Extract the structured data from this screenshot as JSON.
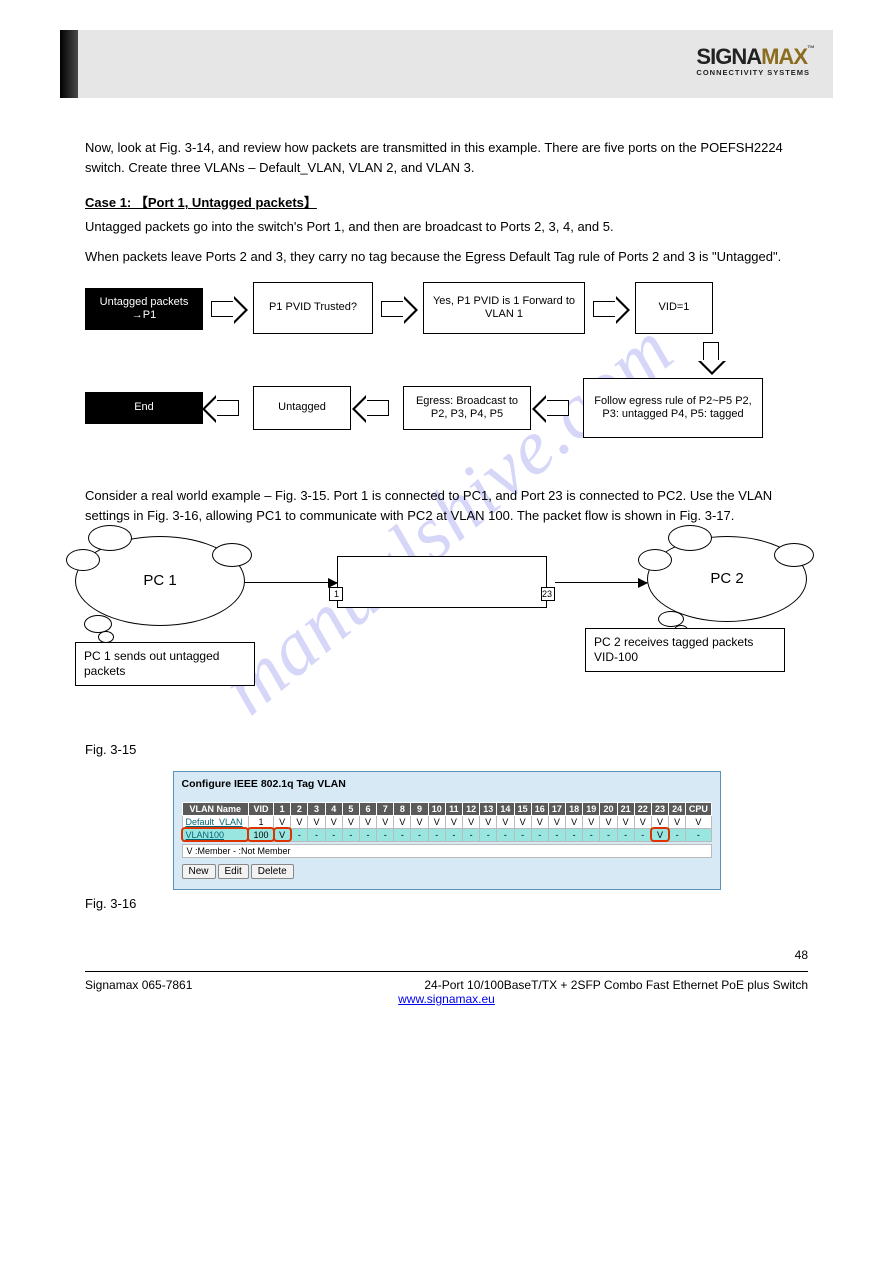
{
  "watermark": "manualshive.com",
  "logo": {
    "left": "SIGNA",
    "right": "MAX",
    "tm": "™",
    "sub": "CONNECTIVITY SYSTEMS"
  },
  "intro": "Now, look at Fig. 3-14, and review how packets are transmitted in this example. There are five ports on the POEFSH2224 switch. Create three VLANs – Default_VLAN, VLAN 2, and VLAN 3.",
  "caseA": {
    "title": "Case 1: 【Port 1, Untagged packets】",
    "p1": "Untagged packets go into the switch's Port 1, and then are broadcast to Ports 2, 3, 4, and 5.",
    "p2": "When packets leave Ports 2 and 3, they carry no tag because the Egress Default Tag rule of Ports 2 and 3 is \"Untagged\"."
  },
  "flow": {
    "box1": "Untagged packets →P1",
    "box2": "P1 PVID Trusted?",
    "box3": "Yes, P1 PVID is 1 Forward to VLAN 1",
    "box4": "VID=1",
    "box5": "Follow egress rule of P2~P5 P2, P3: untagged P4, P5: tagged",
    "box6": "Egress: Broadcast to P2, P3, P4, P5",
    "box7": "Untagged",
    "box8": "End"
  },
  "intro2": "Consider a real world example – Fig. 3-15. Port 1 is connected to PC1, and Port 23 is connected to PC2. Use the VLAN settings in Fig. 3-16, allowing PC1 to communicate with PC2 at VLAN 100. The packet flow is shown in Fig. 3-17.",
  "net": {
    "cloud1": "PC 1",
    "cloud2": "PC 2",
    "port1": "1",
    "port23": "23",
    "tx1": "PC 1 sends out untagged packets",
    "tx2": "PC 2 receives tagged packets VID-100"
  },
  "caption15": "Fig. 3-15",
  "panel": {
    "title": "Configure IEEE 802.1q Tag VLAN",
    "headers": [
      "VLAN Name",
      "VID",
      "1",
      "2",
      "3",
      "4",
      "5",
      "6",
      "7",
      "8",
      "9",
      "10",
      "11",
      "12",
      "13",
      "14",
      "15",
      "16",
      "17",
      "18",
      "19",
      "20",
      "21",
      "22",
      "23",
      "24",
      "CPU"
    ],
    "rows": [
      {
        "name": "Default_VLAN",
        "vid": "1",
        "cells": [
          "V",
          "V",
          "V",
          "V",
          "V",
          "V",
          "V",
          "V",
          "V",
          "V",
          "V",
          "V",
          "V",
          "V",
          "V",
          "V",
          "V",
          "V",
          "V",
          "V",
          "V",
          "V",
          "V",
          "V",
          "V"
        ],
        "hl": false
      },
      {
        "name": "VLAN100",
        "vid": "100",
        "cells": [
          "V",
          "-",
          "-",
          "-",
          "-",
          "-",
          "-",
          "-",
          "-",
          "-",
          "-",
          "-",
          "-",
          "-",
          "-",
          "-",
          "-",
          "-",
          "-",
          "-",
          "-",
          "-",
          "V",
          "-",
          "-"
        ],
        "hl": true
      }
    ],
    "legend": "V :Member    - :Not Member",
    "buttons": [
      "New",
      "Edit",
      "Delete"
    ]
  },
  "caption16": "Fig. 3-16",
  "footer": {
    "left": "Signamax 065-7861",
    "right": "24-Port 10/100BaseT/TX + 2SFP Combo Fast Ethernet PoE plus Switch",
    "page": "48",
    "url": "www.signamax.eu"
  }
}
